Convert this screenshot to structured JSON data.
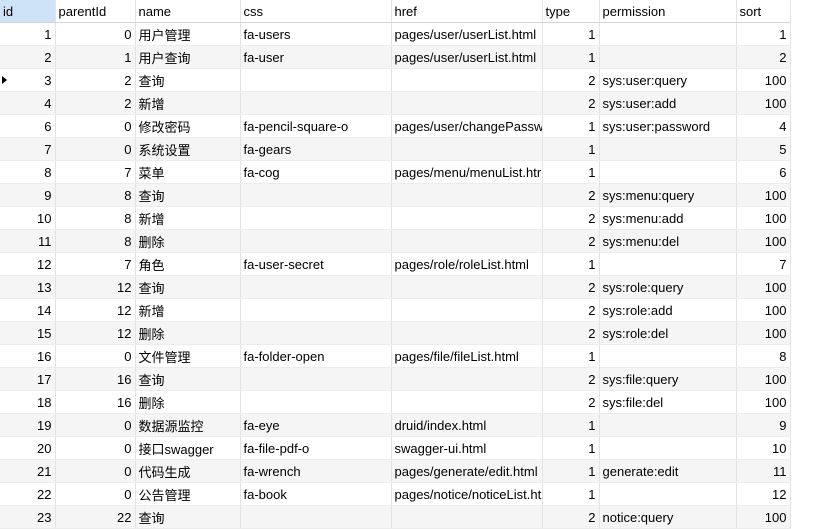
{
  "columns": [
    {
      "key": "id",
      "label": "id",
      "align": "num"
    },
    {
      "key": "parentId",
      "label": "parentId",
      "align": "num"
    },
    {
      "key": "name",
      "label": "name",
      "align": "text"
    },
    {
      "key": "css",
      "label": "css",
      "align": "text"
    },
    {
      "key": "href",
      "label": "href",
      "align": "text"
    },
    {
      "key": "type",
      "label": "type",
      "align": "num"
    },
    {
      "key": "permission",
      "label": "permission",
      "align": "text"
    },
    {
      "key": "sort",
      "label": "sort",
      "align": "num"
    }
  ],
  "current_row": 2,
  "rows": [
    {
      "id": "1",
      "parentId": "0",
      "name": "用户管理",
      "css": "fa-users",
      "href": "pages/user/userList.html",
      "type": "1",
      "permission": "",
      "sort": "1"
    },
    {
      "id": "2",
      "parentId": "1",
      "name": "用户查询",
      "css": "fa-user",
      "href": "pages/user/userList.html",
      "type": "1",
      "permission": "",
      "sort": "2"
    },
    {
      "id": "3",
      "parentId": "2",
      "name": "查询",
      "css": "",
      "href": "",
      "type": "2",
      "permission": "sys:user:query",
      "sort": "100"
    },
    {
      "id": "4",
      "parentId": "2",
      "name": "新增",
      "css": "",
      "href": "",
      "type": "2",
      "permission": "sys:user:add",
      "sort": "100"
    },
    {
      "id": "6",
      "parentId": "0",
      "name": "修改密码",
      "css": "fa-pencil-square-o",
      "href": "pages/user/changePassw",
      "type": "1",
      "permission": "sys:user:password",
      "sort": "4"
    },
    {
      "id": "7",
      "parentId": "0",
      "name": "系统设置",
      "css": "fa-gears",
      "href": "",
      "type": "1",
      "permission": "",
      "sort": "5"
    },
    {
      "id": "8",
      "parentId": "7",
      "name": "菜单",
      "css": "fa-cog",
      "href": "pages/menu/menuList.htr",
      "type": "1",
      "permission": "",
      "sort": "6"
    },
    {
      "id": "9",
      "parentId": "8",
      "name": "查询",
      "css": "",
      "href": "",
      "type": "2",
      "permission": "sys:menu:query",
      "sort": "100"
    },
    {
      "id": "10",
      "parentId": "8",
      "name": "新增",
      "css": "",
      "href": "",
      "type": "2",
      "permission": "sys:menu:add",
      "sort": "100"
    },
    {
      "id": "11",
      "parentId": "8",
      "name": "删除",
      "css": "",
      "href": "",
      "type": "2",
      "permission": "sys:menu:del",
      "sort": "100"
    },
    {
      "id": "12",
      "parentId": "7",
      "name": "角色",
      "css": "fa-user-secret",
      "href": "pages/role/roleList.html",
      "type": "1",
      "permission": "",
      "sort": "7"
    },
    {
      "id": "13",
      "parentId": "12",
      "name": "查询",
      "css": "",
      "href": "",
      "type": "2",
      "permission": "sys:role:query",
      "sort": "100"
    },
    {
      "id": "14",
      "parentId": "12",
      "name": "新增",
      "css": "",
      "href": "",
      "type": "2",
      "permission": "sys:role:add",
      "sort": "100"
    },
    {
      "id": "15",
      "parentId": "12",
      "name": "删除",
      "css": "",
      "href": "",
      "type": "2",
      "permission": "sys:role:del",
      "sort": "100"
    },
    {
      "id": "16",
      "parentId": "0",
      "name": "文件管理",
      "css": "fa-folder-open",
      "href": "pages/file/fileList.html",
      "type": "1",
      "permission": "",
      "sort": "8"
    },
    {
      "id": "17",
      "parentId": "16",
      "name": "查询",
      "css": "",
      "href": "",
      "type": "2",
      "permission": "sys:file:query",
      "sort": "100"
    },
    {
      "id": "18",
      "parentId": "16",
      "name": "删除",
      "css": "",
      "href": "",
      "type": "2",
      "permission": "sys:file:del",
      "sort": "100"
    },
    {
      "id": "19",
      "parentId": "0",
      "name": "数据源监控",
      "css": "fa-eye",
      "href": "druid/index.html",
      "type": "1",
      "permission": "",
      "sort": "9"
    },
    {
      "id": "20",
      "parentId": "0",
      "name": "接口swagger",
      "css": "fa-file-pdf-o",
      "href": "swagger-ui.html",
      "type": "1",
      "permission": "",
      "sort": "10"
    },
    {
      "id": "21",
      "parentId": "0",
      "name": "代码生成",
      "css": "fa-wrench",
      "href": "pages/generate/edit.html",
      "type": "1",
      "permission": "generate:edit",
      "sort": "11"
    },
    {
      "id": "22",
      "parentId": "0",
      "name": "公告管理",
      "css": "fa-book",
      "href": "pages/notice/noticeList.ht",
      "type": "1",
      "permission": "",
      "sort": "12"
    },
    {
      "id": "23",
      "parentId": "22",
      "name": "查询",
      "css": "",
      "href": "",
      "type": "2",
      "permission": "notice:query",
      "sort": "100"
    }
  ]
}
